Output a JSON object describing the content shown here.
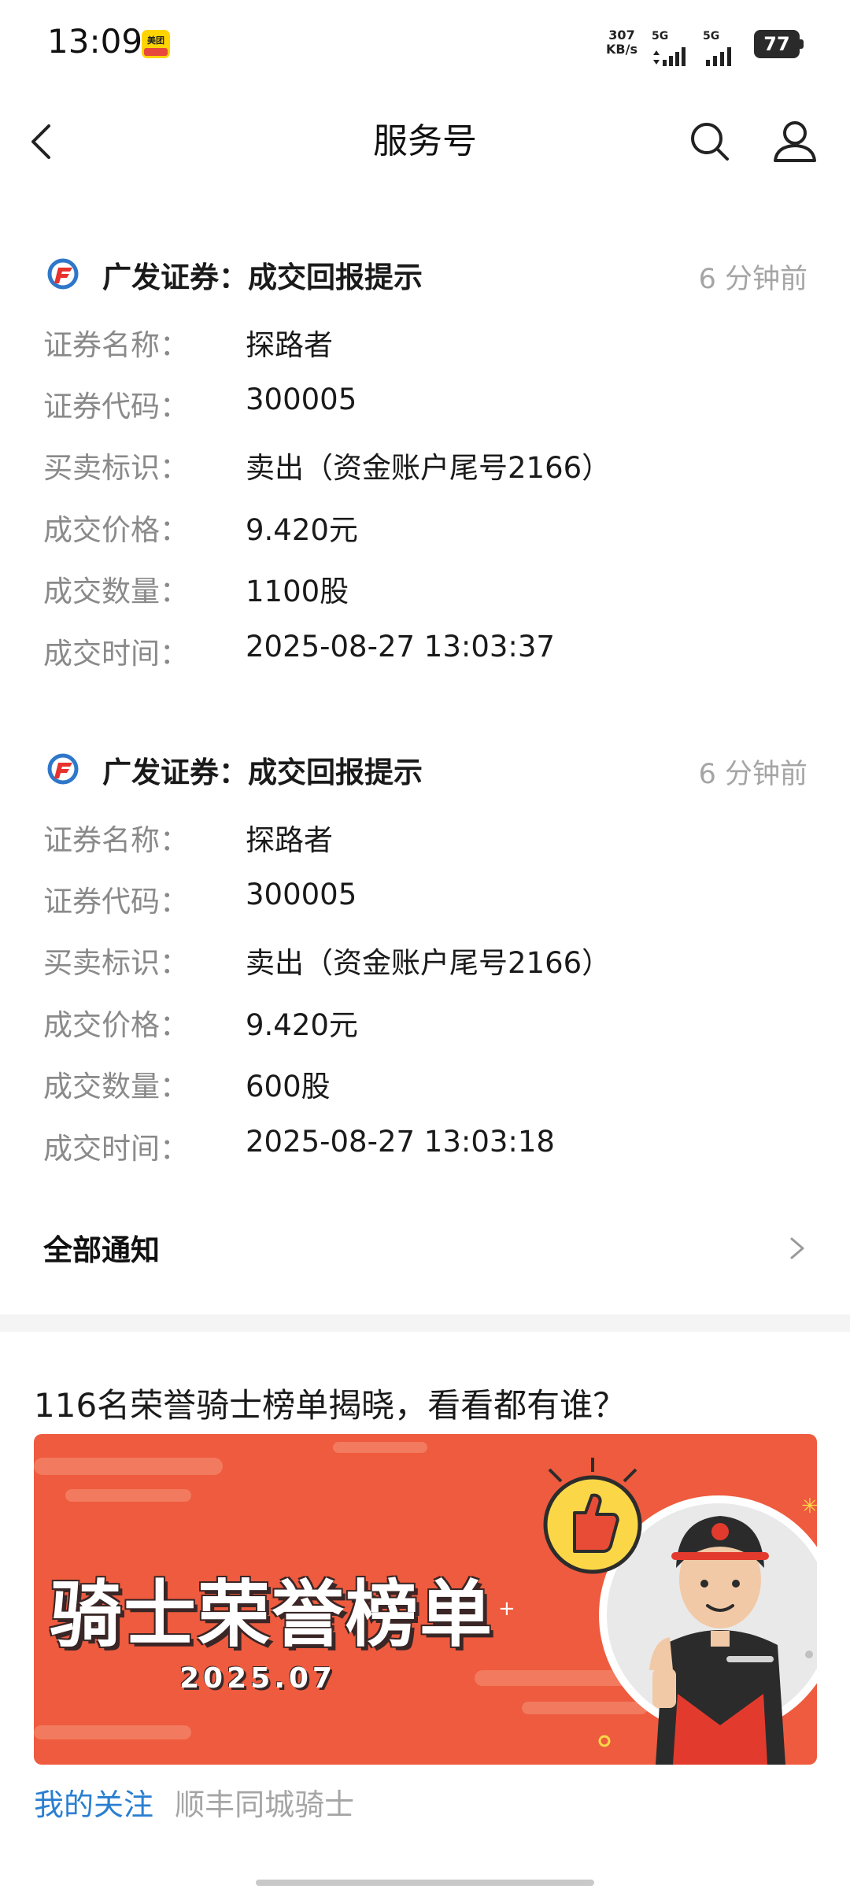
{
  "status_bar": {
    "time": "13:09",
    "app_badge_icon": "meituan-icon",
    "net_speed_value": "307",
    "net_speed_unit": "KB/s",
    "sim1": "5G",
    "sim2": "5G",
    "battery": "77"
  },
  "header": {
    "title": "服务号",
    "back_icon": "back-arrow-icon",
    "search_icon": "search-icon",
    "profile_icon": "user-icon"
  },
  "messages": [
    {
      "title": "广发证券：成交回报提示",
      "time": "6 分钟前",
      "rows": [
        {
          "label": "证券名称：",
          "value": "探路者"
        },
        {
          "label": "证券代码：",
          "value": "300005"
        },
        {
          "label": "买卖标识：",
          "value": "卖出（资金账户尾号2166）"
        },
        {
          "label": "成交价格：",
          "value": "9.420元"
        },
        {
          "label": "成交数量：",
          "value": "1100股"
        },
        {
          "label": "成交时间：",
          "value": "2025-08-27 13:03:37"
        }
      ]
    },
    {
      "title": "广发证券：成交回报提示",
      "time": "6 分钟前",
      "rows": [
        {
          "label": "证券名称：",
          "value": "探路者"
        },
        {
          "label": "证券代码：",
          "value": "300005"
        },
        {
          "label": "买卖标识：",
          "value": "卖出（资金账户尾号2166）"
        },
        {
          "label": "成交价格：",
          "value": "9.420元"
        },
        {
          "label": "成交数量：",
          "value": "600股"
        },
        {
          "label": "成交时间：",
          "value": "2025-08-27 13:03:18"
        }
      ]
    }
  ],
  "all_notifications": {
    "label": "全部通知"
  },
  "promo": {
    "title": "116名荣誉骑士榜单揭晓，看看都有谁？",
    "banner_text": "骑士荣誉榜单",
    "banner_date": "2025.07",
    "follow_label": "我的关注",
    "source": "顺丰同城骑士"
  },
  "colors": {
    "accent_link": "#2a7fd1",
    "banner_bg": "#ee5b3e",
    "muted_text": "#8a8a8a"
  }
}
